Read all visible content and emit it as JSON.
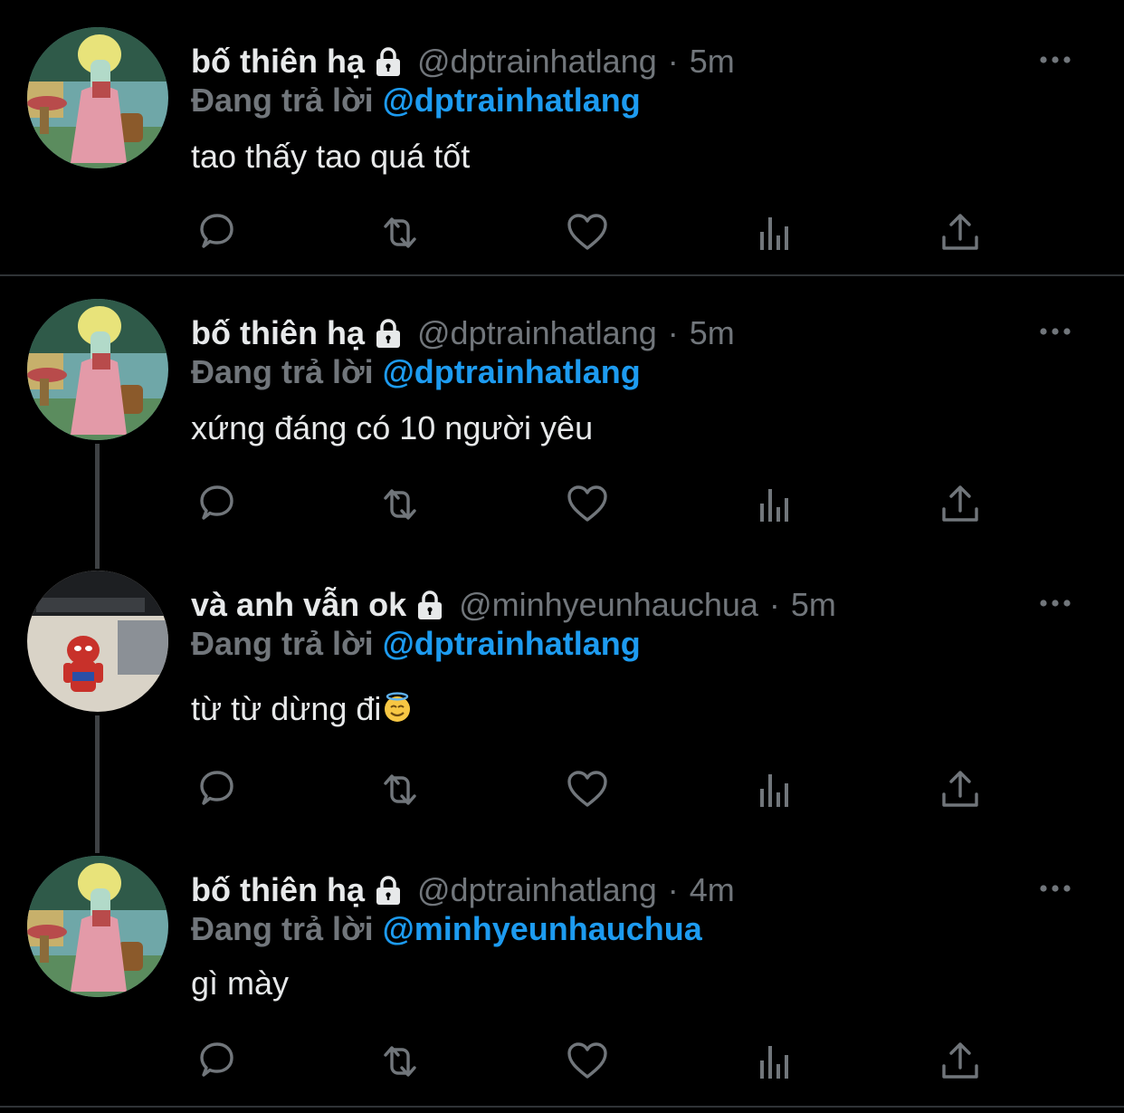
{
  "tweets": [
    {
      "display_name": "bố thiên hạ",
      "handle": "@dptrainhatlang",
      "separator": "·",
      "time": "5m",
      "reply_prefix": "Đang trả lời",
      "reply_mention": "@dptrainhatlang",
      "text": "tao thấy tao quá tốt",
      "avatar": "squidward-avatar"
    },
    {
      "display_name": "bố thiên hạ",
      "handle": "@dptrainhatlang",
      "separator": "·",
      "time": "5m",
      "reply_prefix": "Đang trả lời",
      "reply_mention": "@dptrainhatlang",
      "text": "xứng đáng có 10 người yêu",
      "avatar": "squidward-avatar"
    },
    {
      "display_name": "và anh vẫn ok",
      "handle": "@minhyeunhauchua",
      "separator": "·",
      "time": "5m",
      "reply_prefix": "Đang trả lời",
      "reply_mention": "@dptrainhatlang",
      "text": "từ từ dừng đi",
      "emoji": "smiling-face-with-halo",
      "avatar": "spiderman-figure-avatar"
    },
    {
      "display_name": "bố thiên hạ",
      "handle": "@dptrainhatlang",
      "separator": "·",
      "time": "4m",
      "reply_prefix": "Đang trả lời",
      "reply_mention": "@minhyeunhauchua",
      "text": "gì mày",
      "avatar": "squidward-avatar"
    }
  ],
  "icons": {
    "lock": "lock-icon",
    "more": "more-icon",
    "reply": "reply-icon",
    "retweet": "retweet-icon",
    "like": "like-icon",
    "views": "views-icon",
    "share": "share-icon"
  },
  "colors": {
    "background": "#000000",
    "text": "#e7e9ea",
    "muted": "#71767b",
    "accent": "#1d9bf0",
    "divider": "#2f3336"
  }
}
